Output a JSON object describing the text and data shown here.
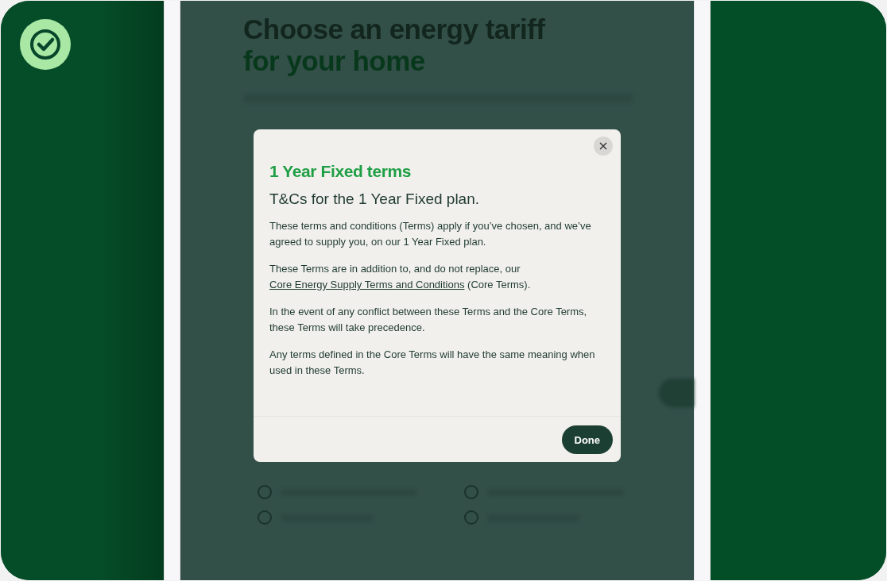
{
  "page": {
    "heading": [
      "Choose an energy tariff",
      "for your home"
    ]
  },
  "modal": {
    "title": "1 Year Fixed terms",
    "subtitle": "T&Cs for the 1 Year Fixed plan.",
    "paragraphs": [
      {
        "parts": [
          {
            "kind": "text",
            "text": "These terms and conditions (Terms) apply if you’ve chosen, and we’ve agreed to supply you, on our 1 Year Fixed plan."
          }
        ]
      },
      {
        "parts": [
          {
            "kind": "text",
            "text": "These Terms are in addition to, and do not replace, our "
          },
          {
            "kind": "link",
            "text": "Core Energy Supply Terms and Conditions"
          },
          {
            "kind": "text",
            "text": " (Core Terms)."
          }
        ]
      },
      {
        "parts": [
          {
            "kind": "text",
            "text": "In the event of any conflict between these Terms and the Core Terms, these Terms will take precedence."
          }
        ]
      },
      {
        "parts": [
          {
            "kind": "text",
            "text": "Any terms defined in the Core Terms will have the same meaning when used in these Terms."
          }
        ]
      }
    ],
    "done_button": "Done"
  }
}
